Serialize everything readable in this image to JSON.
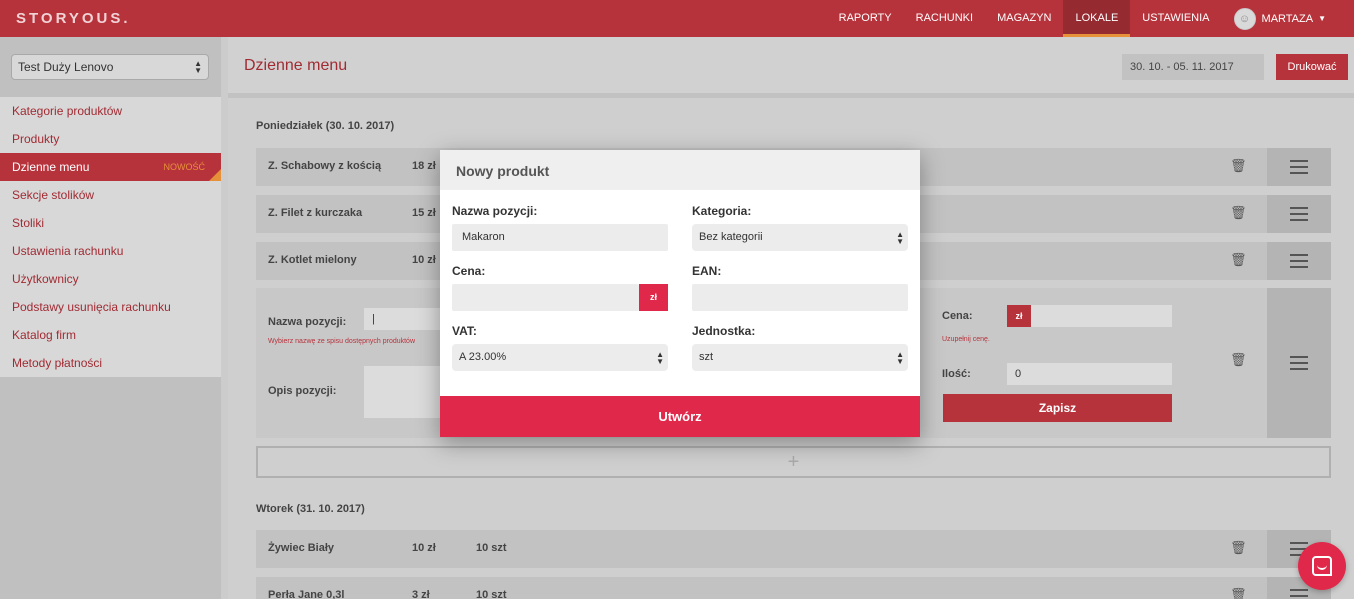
{
  "brand": {
    "logo_text": "STORYOUS."
  },
  "nav": {
    "items": [
      {
        "label": "RAPORTY",
        "active": false
      },
      {
        "label": "RACHUNKI",
        "active": false
      },
      {
        "label": "MAGAZYN",
        "active": false
      },
      {
        "label": "LOKALE",
        "active": true
      },
      {
        "label": "USTAWIENIA",
        "active": false
      }
    ],
    "user_name": "MARTAZA"
  },
  "sidebar": {
    "location_select": "Test Duży Lenovo",
    "items": [
      {
        "label": "Kategorie produktów"
      },
      {
        "label": "Produkty"
      },
      {
        "label": "Dzienne menu",
        "badge": "NOWOŚĆ",
        "active": true
      },
      {
        "label": "Sekcje stolików"
      },
      {
        "label": "Stoliki"
      },
      {
        "label": "Ustawienia rachunku"
      },
      {
        "label": "Użytkownicy"
      },
      {
        "label": "Podstawy usunięcia rachunku"
      },
      {
        "label": "Katalog firm"
      },
      {
        "label": "Metody płatności"
      }
    ]
  },
  "header": {
    "title": "Dzienne menu",
    "date_range": "30. 10. - 05. 11. 2017",
    "print_label": "Drukować"
  },
  "days": [
    {
      "title": "Poniedziałek (30. 10. 2017)",
      "rows": [
        {
          "name": "Z. Schabowy z kością",
          "price": "18 zł"
        },
        {
          "name": "Z. Filet z kurczaka",
          "price": "15 zł"
        },
        {
          "name": "Z. Kotlet mielony",
          "price": "10 zł"
        }
      ],
      "edit_form": {
        "name_label": "Nazwa pozycji:",
        "name_error": "Wybierz nazwę ze spisu dostępnych produktów",
        "desc_label": "Opis pozycji:",
        "price_label": "Cena:",
        "currency": "zł",
        "price_error": "Uzupełnij cenę.",
        "qty_label": "Ilość:",
        "qty_value": "0",
        "save_label": "Zapisz"
      },
      "add_symbol": "+"
    },
    {
      "title": "Wtorek (31. 10. 2017)",
      "rows": [
        {
          "name": "Żywiec Biały",
          "price": "10 zł",
          "qty": "10 szt"
        },
        {
          "name": "Perła Jane 0,3l",
          "price": "3 zł",
          "qty": "10 szt"
        }
      ]
    }
  ],
  "modal": {
    "title": "Nowy produkt",
    "name_label": "Nazwa pozycji:",
    "name_value": "Makaron",
    "category_label": "Kategoria:",
    "category_value": "Bez kategorii",
    "price_label": "Cena:",
    "price_value": "",
    "currency": "zł",
    "ean_label": "EAN:",
    "ean_value": "",
    "vat_label": "VAT:",
    "vat_value": "A 23.00%",
    "unit_label": "Jednostka:",
    "unit_value": "szt",
    "create_label": "Utwórz"
  },
  "icons": {
    "trash": "trash-icon",
    "drag": "hamburger-icon",
    "chat": "chat-icon",
    "avatar": "user-avatar-icon"
  },
  "colors": {
    "brand_red": "#b7333c",
    "modal_accent": "#e0284a",
    "active_tab_underline": "#e6903a"
  }
}
